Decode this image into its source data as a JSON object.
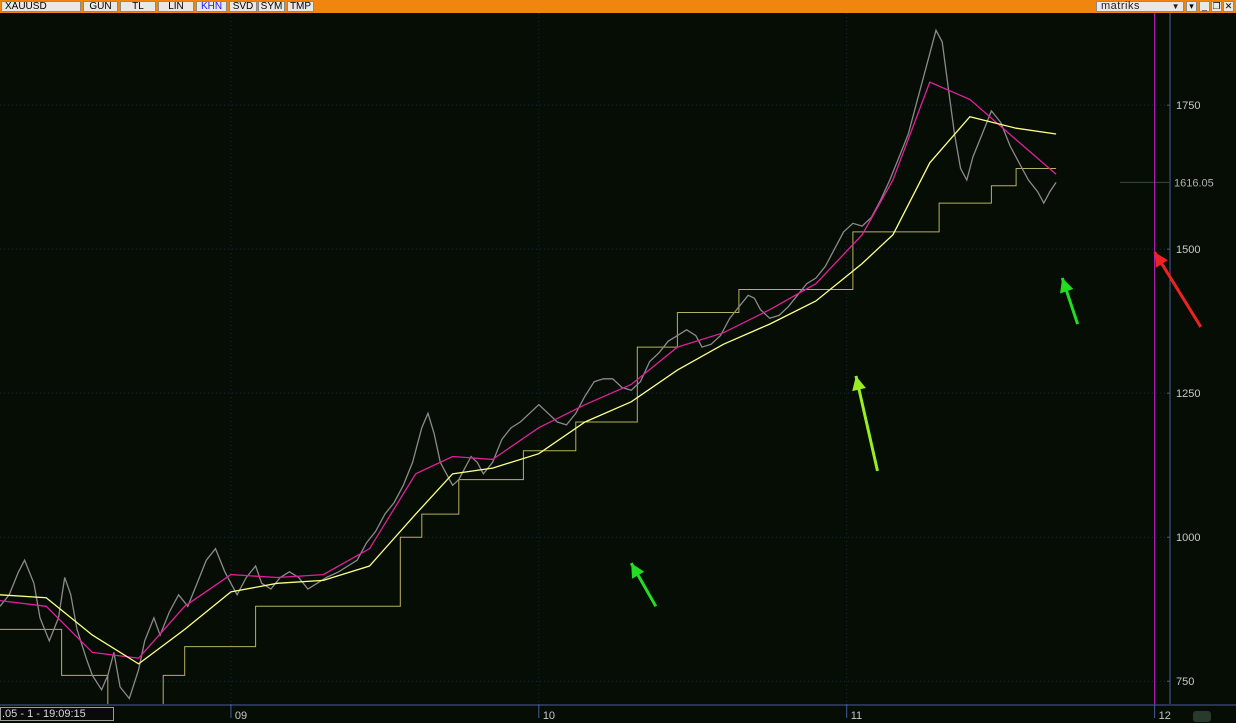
{
  "toolbar": {
    "symbol": "XAUUSD",
    "buttons": [
      {
        "label": "GUN",
        "active": false
      },
      {
        "label": "TL",
        "active": false
      },
      {
        "label": "LIN",
        "active": false
      },
      {
        "label": "KHN",
        "active": true
      },
      {
        "label": "SVD",
        "active": false
      },
      {
        "label": "SYM",
        "active": false
      },
      {
        "label": "TMP",
        "active": false
      }
    ],
    "brand": "matriks"
  },
  "status": {
    "text": ".05 - 1 - 19:09:15"
  },
  "colors": {
    "background": "#050d05",
    "toolbar": "#f0860f",
    "price": "#8a8a8a",
    "magenta_ma": "#e0209a",
    "yellow_ma": "#ffff88",
    "white_line": "#ffffff",
    "blue_line": "#2020ff",
    "orange_line": "#ff6a1a",
    "stop_line": "#b8b060",
    "cursor_line": "#c020c0",
    "grid": "#1c2a3a",
    "axis": "#4a5aa0",
    "arrow_green": "#22dd22",
    "arrow_lime": "#99ee22",
    "arrow_red": "#ee2222"
  },
  "chart_data": {
    "type": "line",
    "title": "XAUUSD",
    "xlabel": "",
    "ylabel": "",
    "ylim": [
      700,
      1910
    ],
    "xlim": [
      2008.25,
      2012.05
    ],
    "y_ticks": [
      750,
      1000,
      1250,
      1500,
      1750
    ],
    "x_ticks": [
      {
        "x": 2009,
        "label": "09"
      },
      {
        "x": 2010,
        "label": "10"
      },
      {
        "x": 2011,
        "label": "11"
      },
      {
        "x": 2012,
        "label": "12"
      }
    ],
    "last_value_label": "1616.05",
    "last_value": 1616.05,
    "cursor_x": 2012.0,
    "grid": true,
    "series": [
      {
        "key": "price",
        "role": "price",
        "values": [
          [
            2008.25,
            880
          ],
          [
            2008.28,
            900
          ],
          [
            2008.31,
            940
          ],
          [
            2008.33,
            960
          ],
          [
            2008.36,
            920
          ],
          [
            2008.38,
            860
          ],
          [
            2008.41,
            820
          ],
          [
            2008.44,
            860
          ],
          [
            2008.46,
            930
          ],
          [
            2008.48,
            900
          ],
          [
            2008.5,
            840
          ],
          [
            2008.53,
            790
          ],
          [
            2008.55,
            760
          ],
          [
            2008.58,
            735
          ],
          [
            2008.6,
            760
          ],
          [
            2008.62,
            800
          ],
          [
            2008.64,
            740
          ],
          [
            2008.67,
            720
          ],
          [
            2008.7,
            770
          ],
          [
            2008.72,
            820
          ],
          [
            2008.75,
            860
          ],
          [
            2008.77,
            830
          ],
          [
            2008.8,
            870
          ],
          [
            2008.83,
            900
          ],
          [
            2008.86,
            880
          ],
          [
            2008.89,
            920
          ],
          [
            2008.92,
            960
          ],
          [
            2008.95,
            980
          ],
          [
            2008.98,
            940
          ],
          [
            2009.0,
            920
          ],
          [
            2009.02,
            900
          ],
          [
            2009.05,
            930
          ],
          [
            2009.08,
            950
          ],
          [
            2009.1,
            920
          ],
          [
            2009.13,
            910
          ],
          [
            2009.16,
            930
          ],
          [
            2009.19,
            940
          ],
          [
            2009.22,
            930
          ],
          [
            2009.25,
            910
          ],
          [
            2009.28,
            920
          ],
          [
            2009.31,
            930
          ],
          [
            2009.35,
            940
          ],
          [
            2009.38,
            950
          ],
          [
            2009.41,
            960
          ],
          [
            2009.44,
            990
          ],
          [
            2009.47,
            1010
          ],
          [
            2009.5,
            1040
          ],
          [
            2009.53,
            1060
          ],
          [
            2009.56,
            1090
          ],
          [
            2009.59,
            1130
          ],
          [
            2009.62,
            1190
          ],
          [
            2009.64,
            1215
          ],
          [
            2009.66,
            1180
          ],
          [
            2009.68,
            1130
          ],
          [
            2009.7,
            1110
          ],
          [
            2009.72,
            1090
          ],
          [
            2009.74,
            1100
          ],
          [
            2009.76,
            1120
          ],
          [
            2009.78,
            1140
          ],
          [
            2009.8,
            1130
          ],
          [
            2009.82,
            1110
          ],
          [
            2009.85,
            1130
          ],
          [
            2009.88,
            1170
          ],
          [
            2009.91,
            1190
          ],
          [
            2009.94,
            1200
          ],
          [
            2009.97,
            1215
          ],
          [
            2010.0,
            1230
          ],
          [
            2010.03,
            1215
          ],
          [
            2010.06,
            1200
          ],
          [
            2010.09,
            1195
          ],
          [
            2010.12,
            1215
          ],
          [
            2010.15,
            1245
          ],
          [
            2010.18,
            1270
          ],
          [
            2010.21,
            1275
          ],
          [
            2010.24,
            1275
          ],
          [
            2010.27,
            1260
          ],
          [
            2010.3,
            1255
          ],
          [
            2010.33,
            1270
          ],
          [
            2010.36,
            1305
          ],
          [
            2010.39,
            1320
          ],
          [
            2010.42,
            1340
          ],
          [
            2010.45,
            1350
          ],
          [
            2010.48,
            1360
          ],
          [
            2010.51,
            1350
          ],
          [
            2010.53,
            1330
          ],
          [
            2010.56,
            1335
          ],
          [
            2010.59,
            1350
          ],
          [
            2010.62,
            1380
          ],
          [
            2010.65,
            1400
          ],
          [
            2010.68,
            1420
          ],
          [
            2010.7,
            1415
          ],
          [
            2010.72,
            1395
          ],
          [
            2010.75,
            1380
          ],
          [
            2010.78,
            1385
          ],
          [
            2010.81,
            1400
          ],
          [
            2010.84,
            1420
          ],
          [
            2010.87,
            1440
          ],
          [
            2010.9,
            1450
          ],
          [
            2010.93,
            1470
          ],
          [
            2010.96,
            1500
          ],
          [
            2010.99,
            1530
          ],
          [
            2011.02,
            1545
          ],
          [
            2011.05,
            1540
          ],
          [
            2011.08,
            1555
          ],
          [
            2011.11,
            1585
          ],
          [
            2011.14,
            1620
          ],
          [
            2011.17,
            1660
          ],
          [
            2011.2,
            1700
          ],
          [
            2011.23,
            1760
          ],
          [
            2011.26,
            1820
          ],
          [
            2011.29,
            1880
          ],
          [
            2011.31,
            1860
          ],
          [
            2011.33,
            1780
          ],
          [
            2011.35,
            1700
          ],
          [
            2011.37,
            1640
          ],
          [
            2011.39,
            1620
          ],
          [
            2011.41,
            1660
          ],
          [
            2011.44,
            1700
          ],
          [
            2011.47,
            1740
          ],
          [
            2011.5,
            1720
          ],
          [
            2011.53,
            1680
          ],
          [
            2011.56,
            1650
          ],
          [
            2011.59,
            1620
          ],
          [
            2011.62,
            1600
          ],
          [
            2011.64,
            1580
          ],
          [
            2011.66,
            1600
          ],
          [
            2011.68,
            1616
          ]
        ]
      },
      {
        "key": "magenta",
        "role": "ma",
        "values": [
          [
            2008.25,
            890
          ],
          [
            2008.4,
            880
          ],
          [
            2008.55,
            800
          ],
          [
            2008.7,
            790
          ],
          [
            2008.85,
            880
          ],
          [
            2009.0,
            935
          ],
          [
            2009.15,
            930
          ],
          [
            2009.3,
            935
          ],
          [
            2009.45,
            980
          ],
          [
            2009.6,
            1110
          ],
          [
            2009.72,
            1140
          ],
          [
            2009.85,
            1135
          ],
          [
            2010.0,
            1190
          ],
          [
            2010.15,
            1230
          ],
          [
            2010.3,
            1265
          ],
          [
            2010.45,
            1330
          ],
          [
            2010.6,
            1355
          ],
          [
            2010.75,
            1395
          ],
          [
            2010.9,
            1440
          ],
          [
            2011.05,
            1525
          ],
          [
            2011.15,
            1620
          ],
          [
            2011.27,
            1790
          ],
          [
            2011.4,
            1760
          ],
          [
            2011.55,
            1690
          ],
          [
            2011.68,
            1630
          ]
        ]
      },
      {
        "key": "yellow",
        "role": "ma",
        "values": [
          [
            2008.25,
            900
          ],
          [
            2008.4,
            895
          ],
          [
            2008.55,
            830
          ],
          [
            2008.7,
            780
          ],
          [
            2008.85,
            840
          ],
          [
            2009.0,
            905
          ],
          [
            2009.15,
            920
          ],
          [
            2009.3,
            925
          ],
          [
            2009.45,
            950
          ],
          [
            2009.6,
            1040
          ],
          [
            2009.72,
            1110
          ],
          [
            2009.85,
            1120
          ],
          [
            2010.0,
            1145
          ],
          [
            2010.15,
            1200
          ],
          [
            2010.3,
            1235
          ],
          [
            2010.45,
            1290
          ],
          [
            2010.6,
            1335
          ],
          [
            2010.75,
            1370
          ],
          [
            2010.9,
            1410
          ],
          [
            2011.05,
            1475
          ],
          [
            2011.15,
            1525
          ],
          [
            2011.27,
            1650
          ],
          [
            2011.4,
            1730
          ],
          [
            2011.55,
            1710
          ],
          [
            2011.68,
            1700
          ]
        ]
      },
      {
        "key": "stop",
        "role": "trailing-stop",
        "values": [
          [
            2008.25,
            840
          ],
          [
            2008.45,
            840
          ],
          [
            2008.45,
            760
          ],
          [
            2008.6,
            760
          ],
          [
            2008.6,
            700
          ],
          [
            2008.78,
            700
          ],
          [
            2008.78,
            760
          ],
          [
            2008.85,
            760
          ],
          [
            2008.85,
            810
          ],
          [
            2009.08,
            810
          ],
          [
            2009.08,
            880
          ],
          [
            2009.55,
            880
          ],
          [
            2009.55,
            1000
          ],
          [
            2009.62,
            1000
          ],
          [
            2009.62,
            1040
          ],
          [
            2009.74,
            1040
          ],
          [
            2009.74,
            1100
          ],
          [
            2009.95,
            1100
          ],
          [
            2009.95,
            1150
          ],
          [
            2010.12,
            1150
          ],
          [
            2010.12,
            1200
          ],
          [
            2010.32,
            1200
          ],
          [
            2010.32,
            1330
          ],
          [
            2010.45,
            1330
          ],
          [
            2010.45,
            1390
          ],
          [
            2010.65,
            1390
          ],
          [
            2010.65,
            1430
          ],
          [
            2011.02,
            1430
          ],
          [
            2011.02,
            1530
          ],
          [
            2011.3,
            1530
          ],
          [
            2011.3,
            1580
          ],
          [
            2011.47,
            1580
          ],
          [
            2011.47,
            1610
          ],
          [
            2011.55,
            1610
          ],
          [
            2011.55,
            1640
          ],
          [
            2011.68,
            1640
          ]
        ]
      }
    ],
    "annotations": [
      {
        "type": "arrow",
        "color": "green",
        "from": [
          2010.38,
          880
        ],
        "to": [
          2010.3,
          955
        ]
      },
      {
        "type": "arrow",
        "color": "lime",
        "from": [
          2011.1,
          1115
        ],
        "to": [
          2011.03,
          1280
        ]
      },
      {
        "type": "arrow",
        "color": "green",
        "from": [
          2011.75,
          1370
        ],
        "to": [
          2011.7,
          1450
        ]
      },
      {
        "type": "arrow",
        "color": "red",
        "from": [
          2012.15,
          1365
        ],
        "to": [
          2012.0,
          1495
        ]
      }
    ]
  }
}
